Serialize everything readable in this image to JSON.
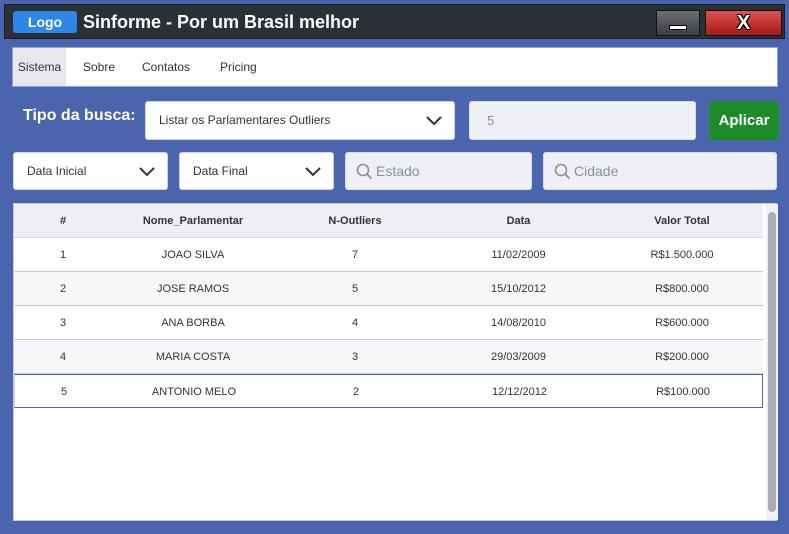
{
  "titlebar": {
    "logo_label": "Logo",
    "title": "Sinforme - Por um Brasil melhor",
    "minimize_icon": "minimize-icon",
    "close_label": "X"
  },
  "nav": {
    "items": [
      {
        "label": "Sistema",
        "active": true
      },
      {
        "label": "Sobre"
      },
      {
        "label": "Contatos"
      },
      {
        "label": "Pricing"
      }
    ]
  },
  "search": {
    "label": "Tipo da busca:",
    "type_value": "Listar os Parlamentares Outliers",
    "count_value": "5",
    "apply_label": "Aplicar",
    "date_start": "Data Inicial",
    "date_end": "Data Final",
    "state_placeholder": "Estado",
    "city_placeholder": "Cidade"
  },
  "table": {
    "headers": [
      "#",
      "Nome_Parlamentar",
      "N-Outliers",
      "Data",
      "Valor Total"
    ],
    "rows": [
      [
        "1",
        "JOAO SILVA",
        "7",
        "11/02/2009",
        "R$1.500.000"
      ],
      [
        "2",
        "JOSE RAMOS",
        "5",
        "15/10/2012",
        "R$800.000"
      ],
      [
        "3",
        "ANA BORBA",
        "4",
        "14/08/2010",
        "R$600.000"
      ],
      [
        "4",
        "MARIA COSTA",
        "3",
        "29/03/2009",
        "R$200.000"
      ],
      [
        "5",
        "ANTONIO MELO",
        "2",
        "12/12/2012",
        "R$100.000"
      ]
    ]
  },
  "colors": {
    "background": "#4a64ad",
    "titlebar": "#2b2f36",
    "logo": "#2e86e6",
    "apply": "#1f8a2a",
    "close": "#c0392b"
  }
}
